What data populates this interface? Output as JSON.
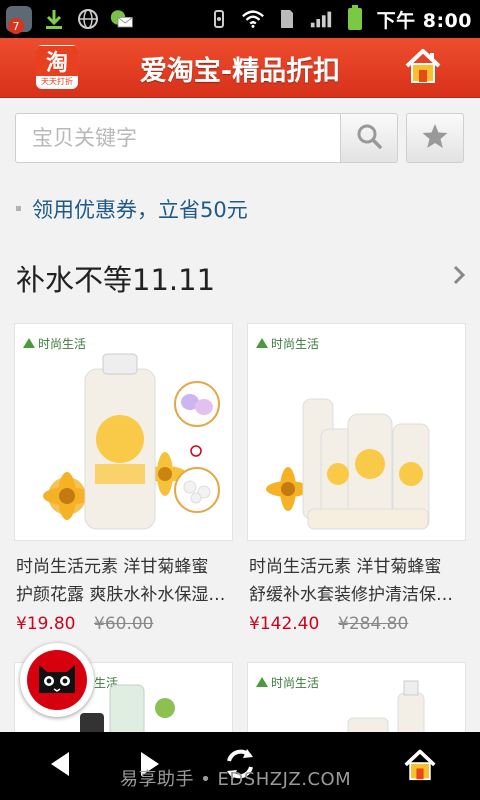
{
  "status_bar": {
    "notification_count": "7",
    "time": "下午 8:00",
    "icons": [
      "app-notification-icon",
      "download-icon",
      "globe-icon",
      "message-icon",
      "vibrate-icon",
      "wifi-icon",
      "sd-card-icon",
      "signal-icon",
      "battery-icon"
    ]
  },
  "header": {
    "logo_char": "淘",
    "logo_sub": "天天打折",
    "title": "爱淘宝-精品折扣",
    "home_icon": "home-icon"
  },
  "search": {
    "placeholder": "宝贝关键字",
    "value": "",
    "search_icon": "search-icon",
    "favorite_icon": "star-icon"
  },
  "coupon": {
    "text": "领用优惠券，立省50元"
  },
  "section": {
    "title": "补水不等11.11",
    "more_icon": "chevron-right-icon"
  },
  "products": [
    {
      "brand": "时尚生活",
      "name_line1": "时尚生活元素 洋甘菊蜂蜜",
      "name_line2": "护颜花露 爽肤水补水保湿…",
      "price": "¥19.80",
      "old_price": "¥60.00"
    },
    {
      "brand": "时尚生活",
      "name_line1": "时尚生活元素 洋甘菊蜂蜜",
      "name_line2": "舒缓补水套装修护清洁保…",
      "price": "¥142.40",
      "old_price": "¥284.80"
    },
    {
      "brand": "时尚生活"
    },
    {
      "brand": "时尚生活"
    }
  ],
  "floating_button": {
    "icon": "tmall-cat-icon"
  },
  "bottom_nav": {
    "back_icon": "back-arrow-icon",
    "forward_icon": "forward-arrow-icon",
    "refresh_icon": "refresh-icon",
    "home_icon": "home-icon",
    "watermark": "易享助手 • EDSHZJZ.COM"
  },
  "colors": {
    "header_red": "#e23e22",
    "link_blue": "#1f5a86",
    "price_red": "#d0021b"
  }
}
